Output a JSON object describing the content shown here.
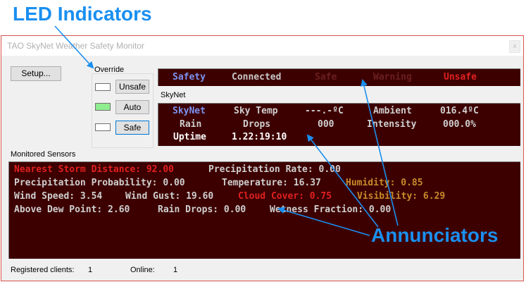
{
  "callouts": {
    "led_indicators": "LED Indicators",
    "annunciators": "Annunciators"
  },
  "window": {
    "title": "TAO SkyNet Weather Safety Monitor",
    "close_glyph": "x"
  },
  "setup_button": "Setup...",
  "override": {
    "label": "Override",
    "items": [
      {
        "label": "Unsafe",
        "led_color": "#ffffff"
      },
      {
        "label": "Auto",
        "led_color": "#90ee90"
      },
      {
        "label": "Safe",
        "led_color": "#ffffff"
      }
    ]
  },
  "status_bar": {
    "safety": "Safety",
    "connected": "Connected",
    "safe": "Safe",
    "warning": "Warning",
    "unsafe": "Unsafe"
  },
  "skynet_section": {
    "label": "SkyNet",
    "row1": {
      "a": "SkyNet",
      "b": "Sky Temp",
      "c": "---.-ºC",
      "d": "Ambient",
      "e": "016.4ºC"
    },
    "row2": {
      "a": "Rain",
      "b": "Drops",
      "c": "000",
      "d": "Intensity",
      "e": "000.0%"
    },
    "row3": {
      "a": "Uptime",
      "b": "1.22:19:10"
    }
  },
  "monitored": {
    "label": "Monitored Sensors",
    "line1": {
      "storm": "Nearest Storm Distance: 92.00",
      "precip_rate": "Precipitation Rate: 0.00"
    },
    "line2": {
      "precip_prob": "Precipitation Probability: 0.00",
      "temperature": "Temperature: 16.37",
      "humidity": "Humidity: 0.85"
    },
    "line3": {
      "wind_speed": "Wind Speed: 3.54",
      "wind_gust": "Wind Gust: 19.60",
      "cloud_cover": "Cloud Cover: 0.75",
      "visibility": "Visibility: 6.29"
    },
    "line4": {
      "dew_point": "Above Dew Point: 2.60",
      "rain_drops": "Rain Drops: 0.00",
      "wetness": "Wetness Fraction: 0.00"
    }
  },
  "footer": {
    "registered_label": "Registered clients:",
    "registered_value": "1",
    "online_label": "Online:",
    "online_value": "1"
  },
  "colors": {
    "annunciator_bg": "#3d0000",
    "callout": "#1a8ff0",
    "alarm_red": "#e02020",
    "warn_orange": "#c88a2a"
  }
}
